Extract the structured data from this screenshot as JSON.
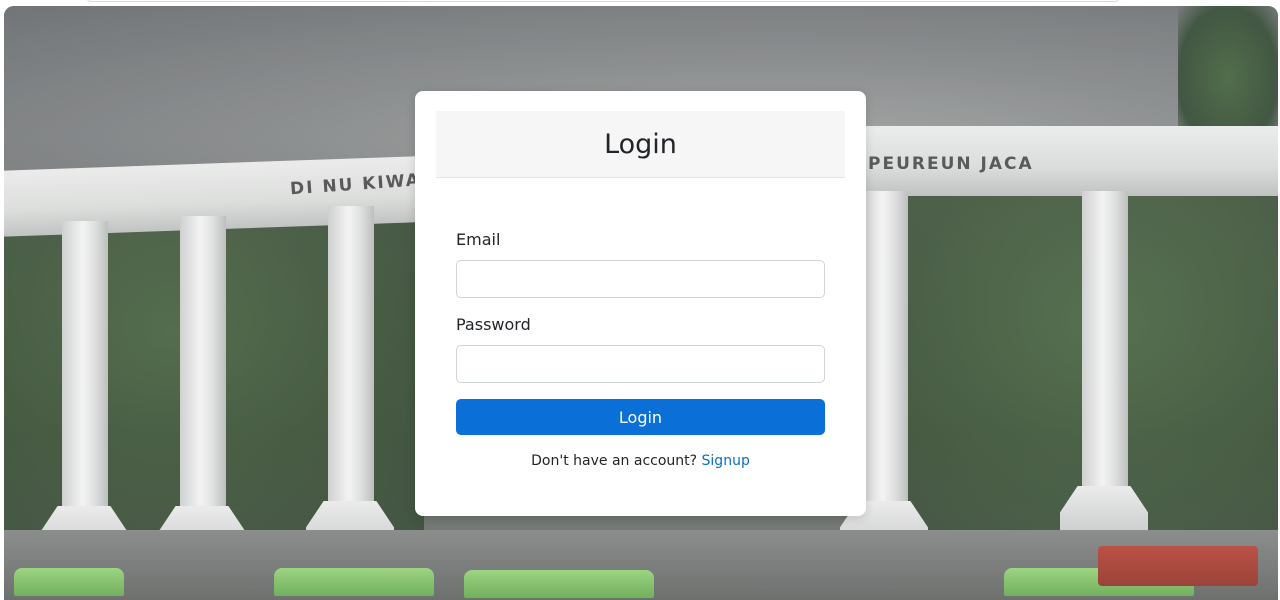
{
  "background": {
    "gate_text_left": "DI NU KIWARI",
    "gate_text_right": "PEUREUN JACA"
  },
  "login_card": {
    "title": "Login",
    "email_label": "Email",
    "email_value": "",
    "password_label": "Password",
    "password_value": "",
    "submit_label": "Login",
    "signup_prompt": "Don't have an account?",
    "signup_link": "Signup"
  },
  "colors": {
    "primary_button": "#0b6fd8",
    "link": "#0a6fc2",
    "card_header_bg": "#f6f6f6"
  }
}
